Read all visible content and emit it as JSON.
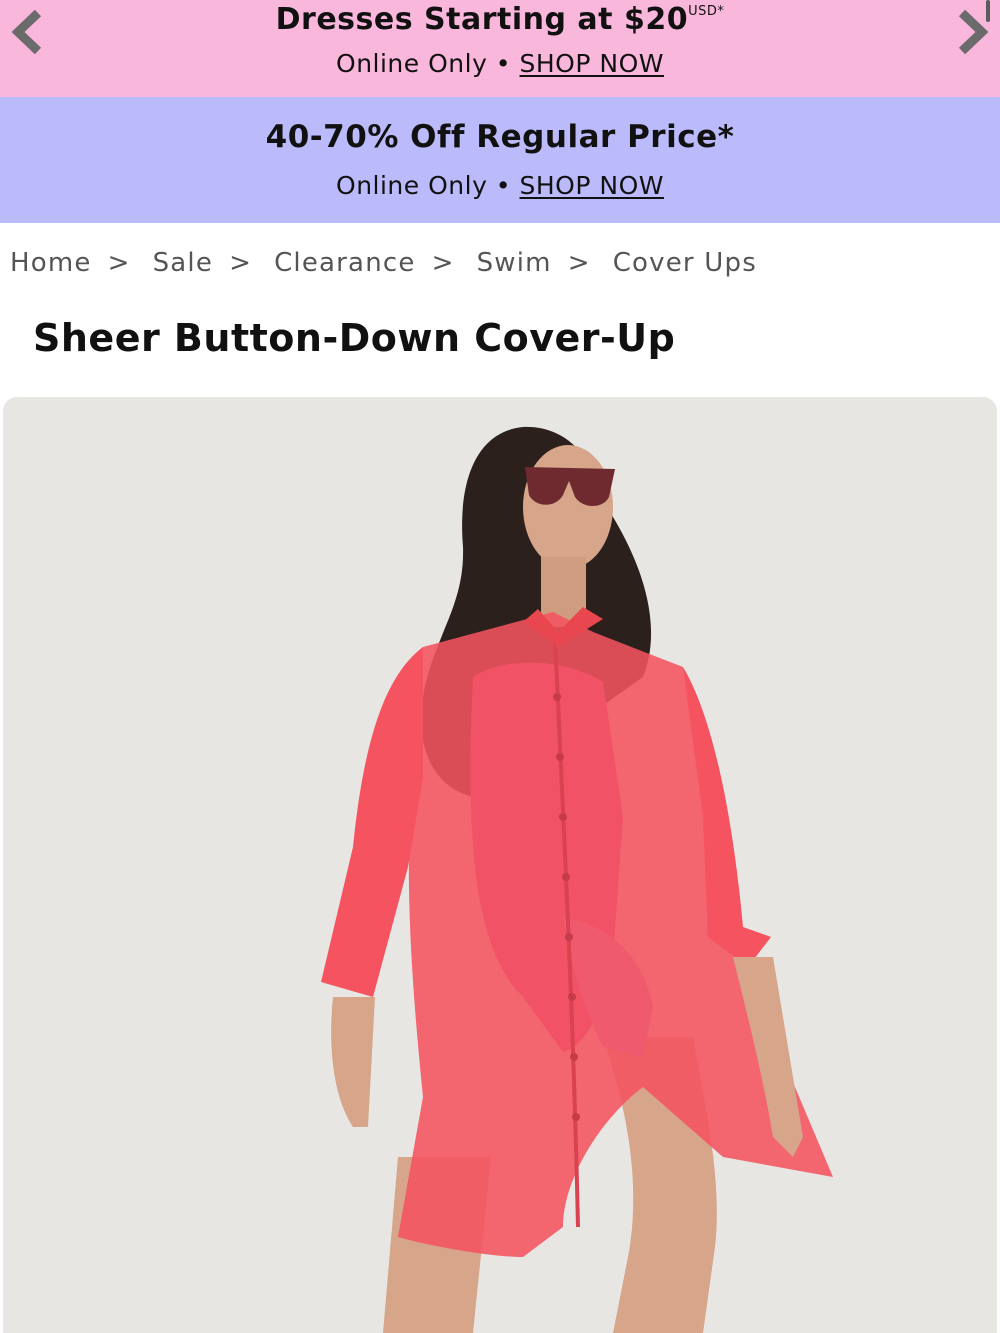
{
  "promo_banners": [
    {
      "headline": "Dresses Starting at $20",
      "headline_superscript": "USD*",
      "online_only": "Online Only •",
      "cta": "SHOP NOW",
      "background": "#fab7dc"
    },
    {
      "headline": "40-70% Off Regular Price*",
      "online_only": "Online Only •",
      "cta": "SHOP NOW",
      "background": "#bbbbfc"
    }
  ],
  "carousel": {
    "prev_icon": "chevron-left-icon",
    "next_icon": "chevron-right-icon",
    "arrow_color": "#6b6b6b"
  },
  "breadcrumb": {
    "items": [
      "Home",
      "Sale",
      "Clearance",
      "Swim",
      "Cover Ups"
    ],
    "separator": ">"
  },
  "product": {
    "title": "Sheer Button-Down Cover-Up",
    "garment_color": "#f4535f",
    "swimsuit_color": "#c98be6",
    "image_background": "#e8e6e3"
  }
}
